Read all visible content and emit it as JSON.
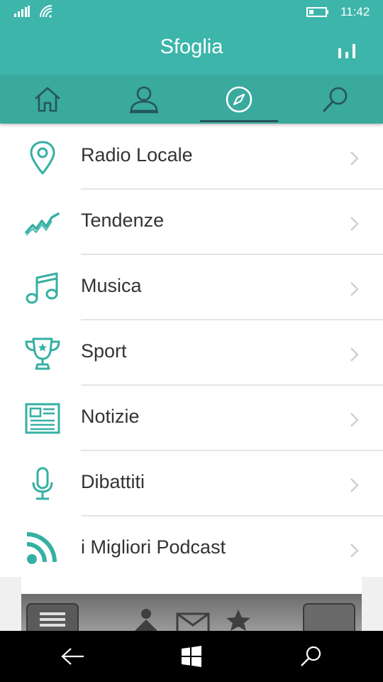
{
  "status": {
    "time": "11:42"
  },
  "header": {
    "title": "Sfoglia"
  },
  "tabs": [
    {
      "icon": "home-icon"
    },
    {
      "icon": "profile-icon"
    },
    {
      "icon": "compass-icon",
      "active": true
    },
    {
      "icon": "search-icon"
    }
  ],
  "list": {
    "items": [
      {
        "label": "Radio Locale",
        "icon": "location-pin-icon"
      },
      {
        "label": "Tendenze",
        "icon": "trend-line-icon"
      },
      {
        "label": "Musica",
        "icon": "music-note-icon"
      },
      {
        "label": "Sport",
        "icon": "trophy-icon"
      },
      {
        "label": "Notizie",
        "icon": "newspaper-icon"
      },
      {
        "label": "Dibattiti",
        "icon": "microphone-icon"
      },
      {
        "label": "i Migliori Podcast",
        "icon": "podcast-feed-icon"
      }
    ]
  },
  "colors": {
    "accent": "#3db5aa",
    "tabbar": "#3aa99e",
    "active_indicator": "#27555a",
    "icon": "#35b0a3"
  }
}
